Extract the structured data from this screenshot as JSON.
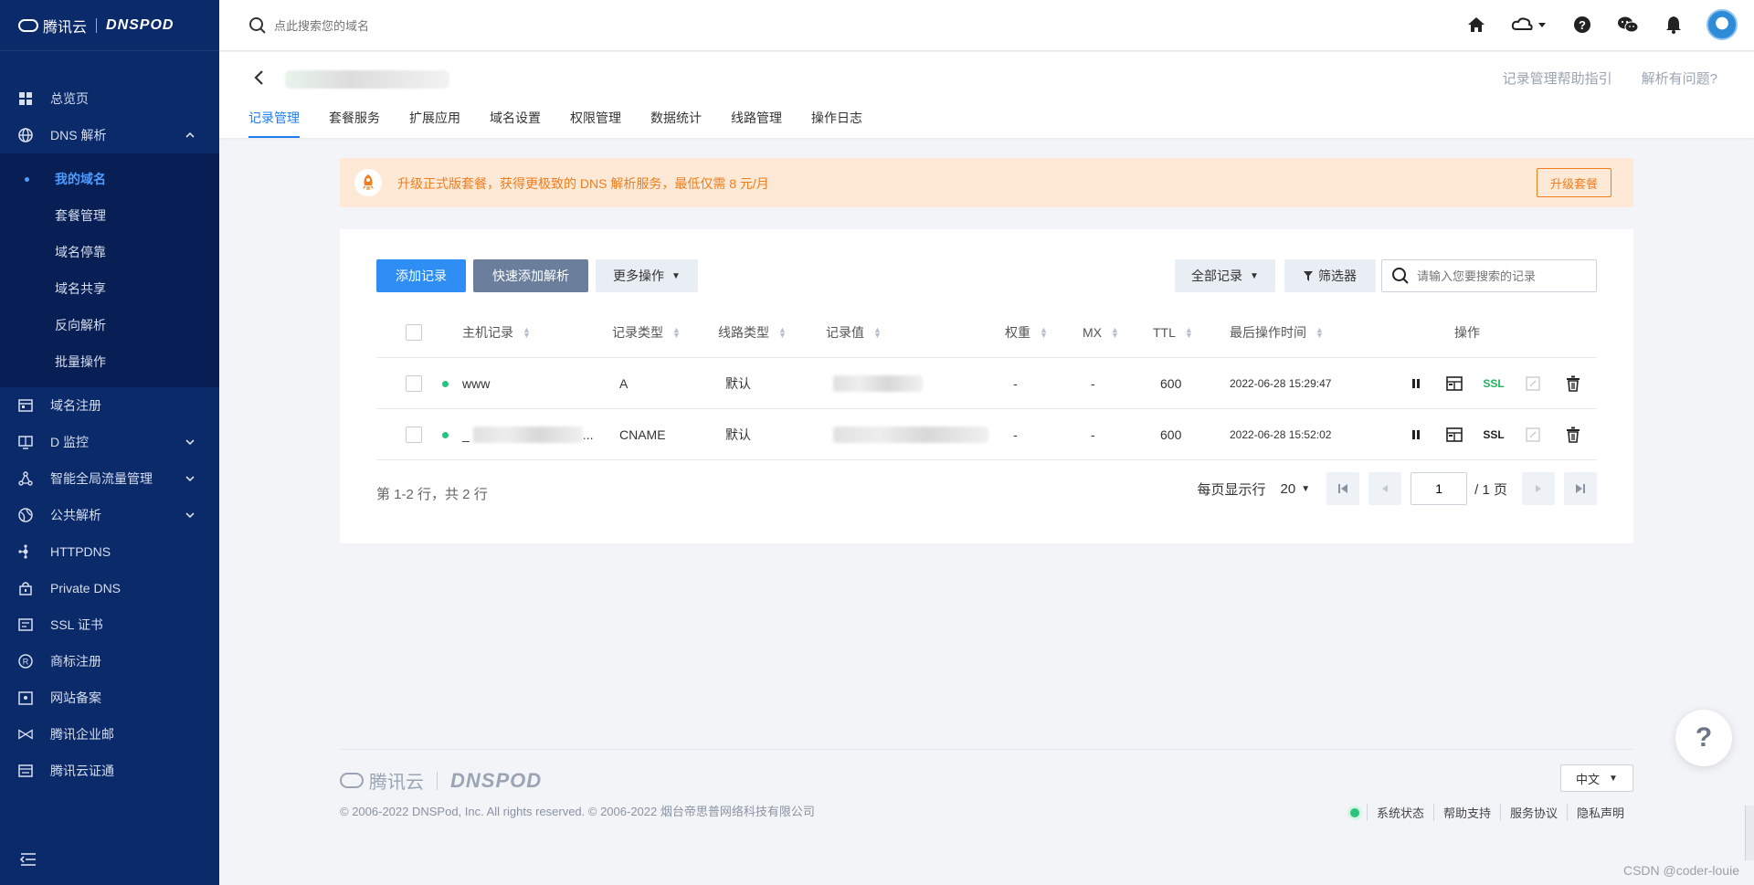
{
  "brand": {
    "tencent": "腾讯云",
    "dnspod": "DNSPOD"
  },
  "sidebar": {
    "items": [
      {
        "label": "总览页"
      },
      {
        "label": "DNS 解析"
      },
      {
        "label": "域名注册"
      },
      {
        "label": "D 监控"
      },
      {
        "label": "智能全局流量管理"
      },
      {
        "label": "公共解析"
      },
      {
        "label": "HTTPDNS"
      },
      {
        "label": "Private DNS"
      },
      {
        "label": "SSL 证书"
      },
      {
        "label": "商标注册"
      },
      {
        "label": "网站备案"
      },
      {
        "label": "腾讯企业邮"
      },
      {
        "label": "腾讯云证通"
      }
    ],
    "dns_submenu": [
      {
        "label": "我的域名"
      },
      {
        "label": "套餐管理"
      },
      {
        "label": "域名停靠"
      },
      {
        "label": "域名共享"
      },
      {
        "label": "反向解析"
      },
      {
        "label": "批量操作"
      }
    ]
  },
  "topbar": {
    "search_placeholder": "点此搜索您的域名"
  },
  "header": {
    "links": [
      "记录管理帮助指引",
      "解析有问题?"
    ],
    "tabs": [
      "记录管理",
      "套餐服务",
      "扩展应用",
      "域名设置",
      "权限管理",
      "数据统计",
      "线路管理",
      "操作日志"
    ]
  },
  "banner": {
    "text": "升级正式版套餐，获得更极致的 DNS 解析服务，最低仅需 8 元/月",
    "button": "升级套餐"
  },
  "toolbar": {
    "add": "添加记录",
    "quick_add": "快速添加解析",
    "more": "更多操作",
    "all_records": "全部记录",
    "filter": "筛选器",
    "search_placeholder": "请输入您要搜索的记录"
  },
  "table": {
    "headers": [
      "主机记录",
      "记录类型",
      "线路类型",
      "记录值",
      "权重",
      "MX",
      "TTL",
      "最后操作时间",
      "操作"
    ],
    "rows": [
      {
        "host": "www",
        "type": "A",
        "line": "默认",
        "weight": "-",
        "mx": "-",
        "ttl": "600",
        "time": "2022-06-28 15:29:47",
        "ssl": "SSL"
      },
      {
        "host": "_",
        "host_suffix": "...",
        "type": "CNAME",
        "line": "默认",
        "weight": "-",
        "mx": "-",
        "ttl": "600",
        "time": "2022-06-28 15:52:02",
        "ssl": "SSL"
      }
    ]
  },
  "pagination": {
    "summary": "第 1-2 行，共 2 行",
    "per_page_label": "每页显示行",
    "per_page": "20",
    "current": "1",
    "total": "/ 1 页"
  },
  "footer": {
    "copyright": "© 2006-2022 DNSPod, Inc. All rights reserved. © 2006-2022 烟台帝思普网络科技有限公司",
    "lang": "中文",
    "links": [
      "系统状态",
      "帮助支持",
      "服务协议",
      "隐私声明"
    ]
  },
  "help_float": "?",
  "watermark": "CSDN @coder-louie",
  "colors": {
    "sidebar": "#0b2a6a",
    "primary": "#2e8ef3",
    "banner_text": "#f07d1f",
    "status_green": "#29c27f"
  }
}
